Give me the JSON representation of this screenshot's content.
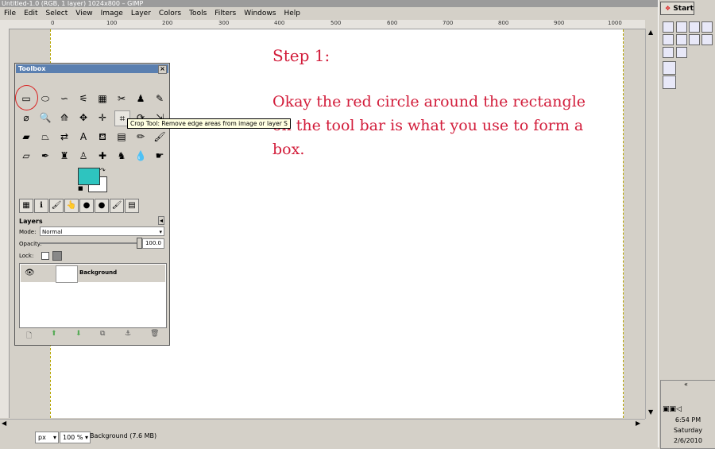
{
  "window": {
    "title": "Untitled-1.0 (RGB, 1 layer) 1024x800 – GIMP"
  },
  "menu": [
    "File",
    "Edit",
    "Select",
    "View",
    "Image",
    "Layer",
    "Colors",
    "Tools",
    "Filters",
    "Windows",
    "Help"
  ],
  "ruler": {
    "ticks": [
      "0",
      "100",
      "200",
      "300",
      "400",
      "500",
      "600",
      "700",
      "800",
      "900",
      "1000"
    ]
  },
  "canvas_text": {
    "title": "Step 1:",
    "body": "Okay the red circle around the rectangle on the tool bar is what you use to form a box."
  },
  "toolbox": {
    "title": "Toolbox",
    "close": "×",
    "tools": [
      {
        "icon": "rect-select-icon",
        "glyph": "▭"
      },
      {
        "icon": "ellipse-select-icon",
        "glyph": "⬭"
      },
      {
        "icon": "free-select-icon",
        "glyph": "∽"
      },
      {
        "icon": "fuzzy-select-icon",
        "glyph": "⚟"
      },
      {
        "icon": "color-select-icon",
        "glyph": "▦"
      },
      {
        "icon": "scissors-icon",
        "glyph": "✂"
      },
      {
        "icon": "foreground-select-icon",
        "glyph": "♟"
      },
      {
        "icon": "paths-icon",
        "glyph": "✎"
      },
      {
        "icon": "color-picker-icon",
        "glyph": "⌀"
      },
      {
        "icon": "zoom-icon",
        "glyph": "🔍"
      },
      {
        "icon": "measure-icon",
        "glyph": "⟰"
      },
      {
        "icon": "move-icon",
        "glyph": "✥"
      },
      {
        "icon": "align-icon",
        "glyph": "✛"
      },
      {
        "icon": "crop-icon",
        "glyph": "⌗"
      },
      {
        "icon": "rotate-icon",
        "glyph": "⟳"
      },
      {
        "icon": "scale-icon",
        "glyph": "⇲"
      },
      {
        "icon": "shear-icon",
        "glyph": "▰"
      },
      {
        "icon": "perspective-icon",
        "glyph": "⏢"
      },
      {
        "icon": "flip-icon",
        "glyph": "⇄"
      },
      {
        "icon": "text-icon",
        "glyph": "A"
      },
      {
        "icon": "bucket-fill-icon",
        "glyph": "⛾"
      },
      {
        "icon": "blend-icon",
        "glyph": "▤"
      },
      {
        "icon": "pencil-icon",
        "glyph": "✏"
      },
      {
        "icon": "paintbrush-icon",
        "glyph": "🖌"
      },
      {
        "icon": "eraser-icon",
        "glyph": "▱"
      },
      {
        "icon": "airbrush-icon",
        "glyph": "✒"
      },
      {
        "icon": "ink-icon",
        "glyph": "♜"
      },
      {
        "icon": "clone-icon",
        "glyph": "♙"
      },
      {
        "icon": "heal-icon",
        "glyph": "✚"
      },
      {
        "icon": "perspective-clone-icon",
        "glyph": "♞"
      },
      {
        "icon": "blur-icon",
        "glyph": "💧"
      },
      {
        "icon": "smudge-icon",
        "glyph": "☛"
      }
    ],
    "colors": {
      "foreground": "#2ec4bf",
      "background": "#ffffff"
    },
    "tabs": [
      "▦",
      "ℹ",
      "🖌",
      "👆",
      "●",
      "●",
      "🖌",
      "▤"
    ]
  },
  "tooltip": {
    "text": "Crop Tool: Remove edge areas from image or layer  S"
  },
  "layers": {
    "title": "Layers",
    "mode_label": "Mode:",
    "mode_value": "Normal",
    "opacity_label": "Opacity:",
    "opacity_value": "100.0",
    "lock_label": "Lock:",
    "items": [
      {
        "name": "Background",
        "visible": true
      }
    ],
    "buttons": [
      "🗋",
      "⬆",
      "⬇",
      "⧉",
      "⚓",
      "🗑"
    ]
  },
  "status": {
    "unit": "px",
    "zoom": "100 %",
    "text": "Background (7.6 MB)"
  },
  "taskbar": {
    "start": "Start",
    "time": "6:54 PM",
    "day": "Saturday",
    "date": "2/6/2010",
    "collapse": "«"
  },
  "accent_colors": {
    "annotation_red": "#d21c3a",
    "title_blue": "#5a7fb0"
  }
}
